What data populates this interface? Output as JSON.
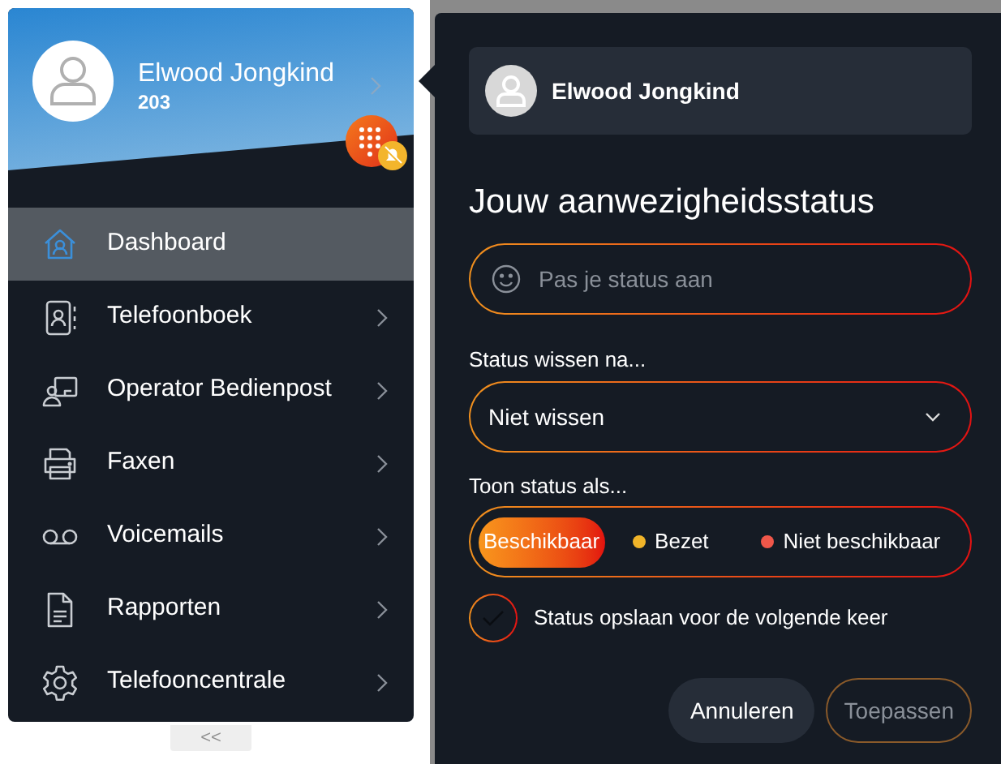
{
  "user": {
    "name": "Elwood Jongkind",
    "extension": "203"
  },
  "nav": [
    {
      "label": "Dashboard",
      "selected": true,
      "submenu": false
    },
    {
      "label": "Telefoonboek",
      "selected": false,
      "submenu": true
    },
    {
      "label": "Operator Bedienpost",
      "selected": false,
      "submenu": true
    },
    {
      "label": "Faxen",
      "selected": false,
      "submenu": true
    },
    {
      "label": "Voicemails",
      "selected": false,
      "submenu": true
    },
    {
      "label": "Rapporten",
      "selected": false,
      "submenu": true
    },
    {
      "label": "Telefooncentrale",
      "selected": false,
      "submenu": true
    }
  ],
  "collapse": "<<",
  "status_panel": {
    "user_name": "Elwood Jongkind",
    "title": "Jouw aanwezigheidsstatus",
    "status_field": {
      "placeholder": "Pas je status aan"
    },
    "clear_label": "Status wissen na...",
    "clear_select": {
      "value": "Niet wissen"
    },
    "show_label": "Toon status als...",
    "show_options": [
      {
        "label": "Beschikbaar",
        "selected": true
      },
      {
        "label": "Bezet",
        "selected": false,
        "color": "#f0b429"
      },
      {
        "label": "Niet beschikbaar",
        "selected": false,
        "color": "#f0574a"
      }
    ],
    "save": {
      "label": "Status opslaan voor de volgende keer",
      "checked": false
    },
    "buttons": [
      {
        "label": "Annuleren",
        "kind": "secondary",
        "disabled": false
      },
      {
        "label": "Toepassen",
        "kind": "primary",
        "disabled": true
      }
    ]
  }
}
